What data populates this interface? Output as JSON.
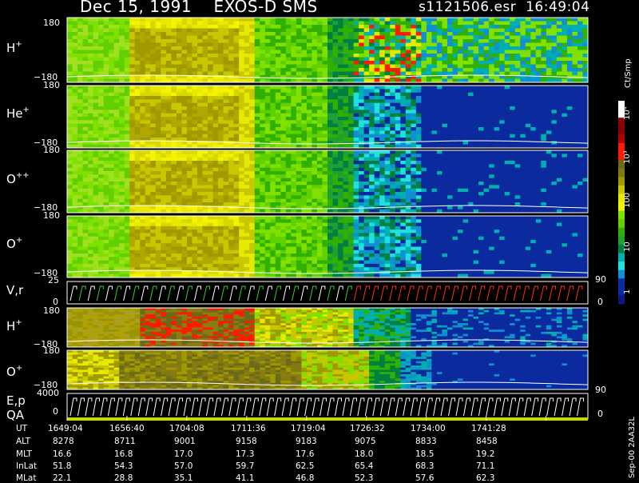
{
  "header": {
    "title": "Dec 15, 1991    EXOS-D SMS",
    "file": "s1121506.esr  16:49:04"
  },
  "colorbar": {
    "unit": "Ct/Smp",
    "ticks": [
      "10⁴",
      "10³",
      "100",
      "10",
      "1"
    ],
    "colors": [
      "#ffffff",
      "#ffffff",
      "#8a0008",
      "#8a0008",
      "#b00000",
      "#ff1a00",
      "#ff1a00",
      "#6b6a18",
      "#807a10",
      "#a09a00",
      "#c8c800",
      "#e8e800",
      "#f4f400",
      "#80e000",
      "#60d000",
      "#30b000",
      "#20a030",
      "#008040",
      "#00b0b0",
      "#20e0e0",
      "#1090d0",
      "#0a2a9e",
      "#0a2a9e",
      "#0a1a80"
    ]
  },
  "rows": {
    "ut_label": "UT",
    "ut": [
      "1649:04",
      "1656:40",
      "1704:08",
      "1711:36",
      "1719:04",
      "1726:32",
      "1734:00",
      "1741:28"
    ],
    "alt_label": "ALT",
    "alt": [
      "8278",
      "8711",
      "9001",
      "9158",
      "9183",
      "9075",
      "8833",
      "8458"
    ],
    "mlt_label": "MLT",
    "mlt": [
      "16.6",
      "16.8",
      "17.0",
      "17.3",
      "17.6",
      "18.0",
      "18.5",
      "19.2"
    ],
    "inlat_label": "InLat",
    "inlat": [
      "51.8",
      "54.3",
      "57.0",
      "59.7",
      "62.5",
      "65.4",
      "68.3",
      "71.1"
    ],
    "mlat_label": "MLat",
    "mlat": [
      "22.1",
      "28.8",
      "35.1",
      "41.1",
      "46.8",
      "52.3",
      "57.6",
      "62.3"
    ]
  },
  "side_label": "Sep-00  2AA32L",
  "panel_labels": {
    "h1": "H",
    "h1_sup": "+",
    "he": "He",
    "he_sup": "+",
    "opp": "O",
    "opp_sup": "++",
    "o1": "O",
    "o1_sup": "+",
    "vr": "V,r",
    "h2": "H",
    "h2_sup": "+",
    "o2": "O",
    "o2_sup": "+",
    "ep": "E,p",
    "qa": "QA"
  },
  "ticks": {
    "p180": "180",
    "m180": "−180",
    "v25": "25",
    "v0": "0",
    "e4000": "4000",
    "e0": "0",
    "r90": "90",
    "r0": "0"
  },
  "chart_data": {
    "type": "heatmap",
    "title": "Dec 15, 1991    EXOS-D SMS",
    "x_axis": "UT",
    "x_ticks": [
      "1649:04",
      "1656:40",
      "1704:08",
      "1711:36",
      "1719:04",
      "1726:32",
      "1734:00",
      "1741:28"
    ],
    "panels": [
      {
        "name": "H+",
        "ylim": [
          -180,
          180
        ]
      },
      {
        "name": "He+",
        "ylim": [
          -180,
          180
        ]
      },
      {
        "name": "O++",
        "ylim": [
          -180,
          180
        ]
      },
      {
        "name": "O+",
        "ylim": [
          -180,
          180
        ]
      },
      {
        "name": "V,r",
        "ylim": [
          0,
          25
        ],
        "right_ylim": [
          0,
          90
        ]
      },
      {
        "name": "H+",
        "ylim": [
          -180,
          180
        ]
      },
      {
        "name": "O+",
        "ylim": [
          -180,
          180
        ]
      },
      {
        "name": "E,p",
        "ylim": [
          0,
          4000
        ],
        "right_ylim": [
          0,
          90
        ]
      }
    ],
    "colorscale_unit": "Ct/Smp",
    "colorscale_ticks": [
      "1",
      "10",
      "100",
      "10³",
      "10⁴"
    ]
  }
}
